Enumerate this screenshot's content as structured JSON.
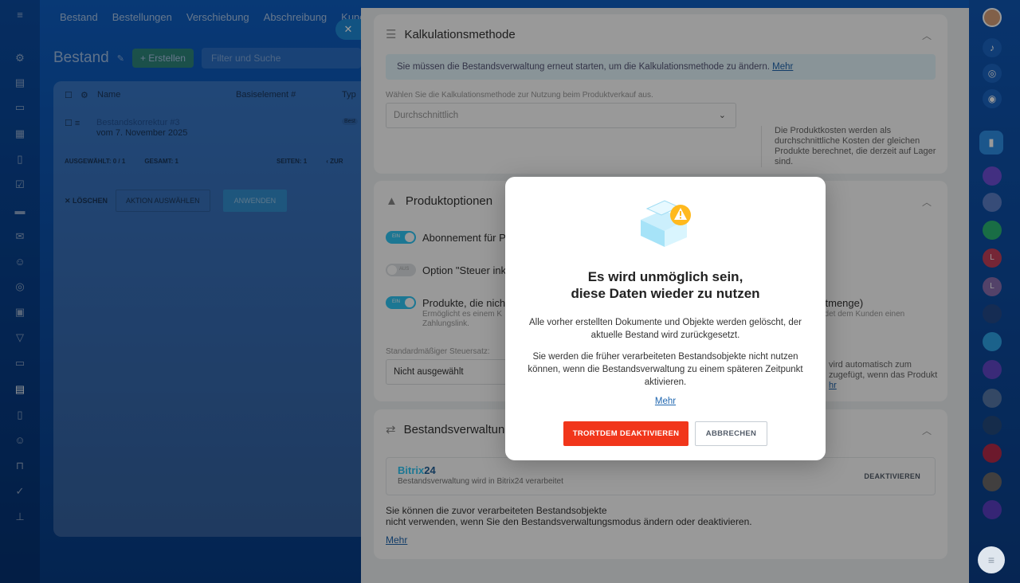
{
  "top_nav": [
    "Bestand",
    "Bestellungen",
    "Verschiebung",
    "Abschreibung",
    "Kunden"
  ],
  "page": {
    "title": "Bestand",
    "create_label": "+ Erstellen",
    "filter_placeholder": "Filter und Suche"
  },
  "list": {
    "headers": [
      "Name",
      "Basiselement #",
      "Typ"
    ],
    "row_title": "Bestandskorrektur #3",
    "row_date": "vom 7. November 2025",
    "row_badge": "Best",
    "footer_selected": "AUSGEWÄHLT: 0 / 1",
    "footer_total": "GESAMT: 1",
    "footer_pages": "SEITEN: 1",
    "footer_back": "‹ ZUR",
    "delete_label": "✕ LÖSCHEN",
    "action_label": "AKTION AUSWÄHLEN",
    "apply_label": "ANWENDEN"
  },
  "slider": {
    "section1": {
      "title": "Kalkulationsmethode",
      "notice": "Sie müssen die Bestandsverwaltung erneut starten, um die Kalkulationsmethode zu ändern.",
      "notice_link": "Mehr",
      "select_label": "Wählen Sie die Kalkulationsmethode zur Nutzung beim Produktverkauf aus.",
      "select_value": "Durchschnittlich",
      "hint": "Die Produktkosten werden als durchschnittliche Kosten der gleichen Produkte berechnet, die derzeit auf Lager sind."
    },
    "section2": {
      "title": "Produktoptionen",
      "opt1": "Abonnement für Pr",
      "opt1_toggle": "EIN",
      "opt2": "Option \"Steuer inkl",
      "opt2_toggle": "AUS",
      "opt3": "Produkte, die nicht",
      "opt3_toggle": "EIN",
      "opt3_sub": "Ermöglicht es einem K",
      "opt3_sub2": "Zahlungslink.",
      "opt3_right": "ktmenge)",
      "opt3_right_sub": "ndet dem Kunden einen",
      "tax_label": "Standardmäßiger Steuersatz:",
      "tax_value": "Nicht ausgewählt",
      "tax_right1": "vird automatisch zum",
      "tax_right2": "zugefügt, wenn das Produkt",
      "tax_right_link": "hr"
    },
    "section3": {
      "title": "Bestandsverwaltung",
      "provider_name": "Bitrix",
      "provider_num": "24",
      "provider_sub": "Bestandsverwaltung wird in Bitrix24 verarbeitet",
      "deactivate_label": "DEAKTIVIEREN",
      "note1": "Sie können die zuvor verarbeiteten Bestandsobjekte",
      "note2": "nicht verwenden, wenn Sie den Bestandsverwaltungsmodus ändern oder deaktivieren.",
      "note_link": "Mehr"
    }
  },
  "modal": {
    "title_line1": "Es wird unmöglich sein,",
    "title_line2": "diese Daten wieder zu nutzen",
    "para1": "Alle vorher erstellten Dokumente und Objekte werden gelöscht, der aktuelle Bestand wird zurückgesetzt.",
    "para2": "Sie werden die früher verarbeiteten Bestandsobjekte nicht nutzen können, wenn die Bestandsverwaltung zu einem späteren Zeitpunkt aktivieren.",
    "link": "Mehr",
    "confirm_label": "TRORTDEM DEAKTIVIEREN",
    "cancel_label": "ABBRECHEN"
  },
  "colors": {
    "accent": "#2fc6f6",
    "danger": "#f1361b",
    "link": "#2067b0",
    "bg_blue": "#0b4fa8"
  }
}
